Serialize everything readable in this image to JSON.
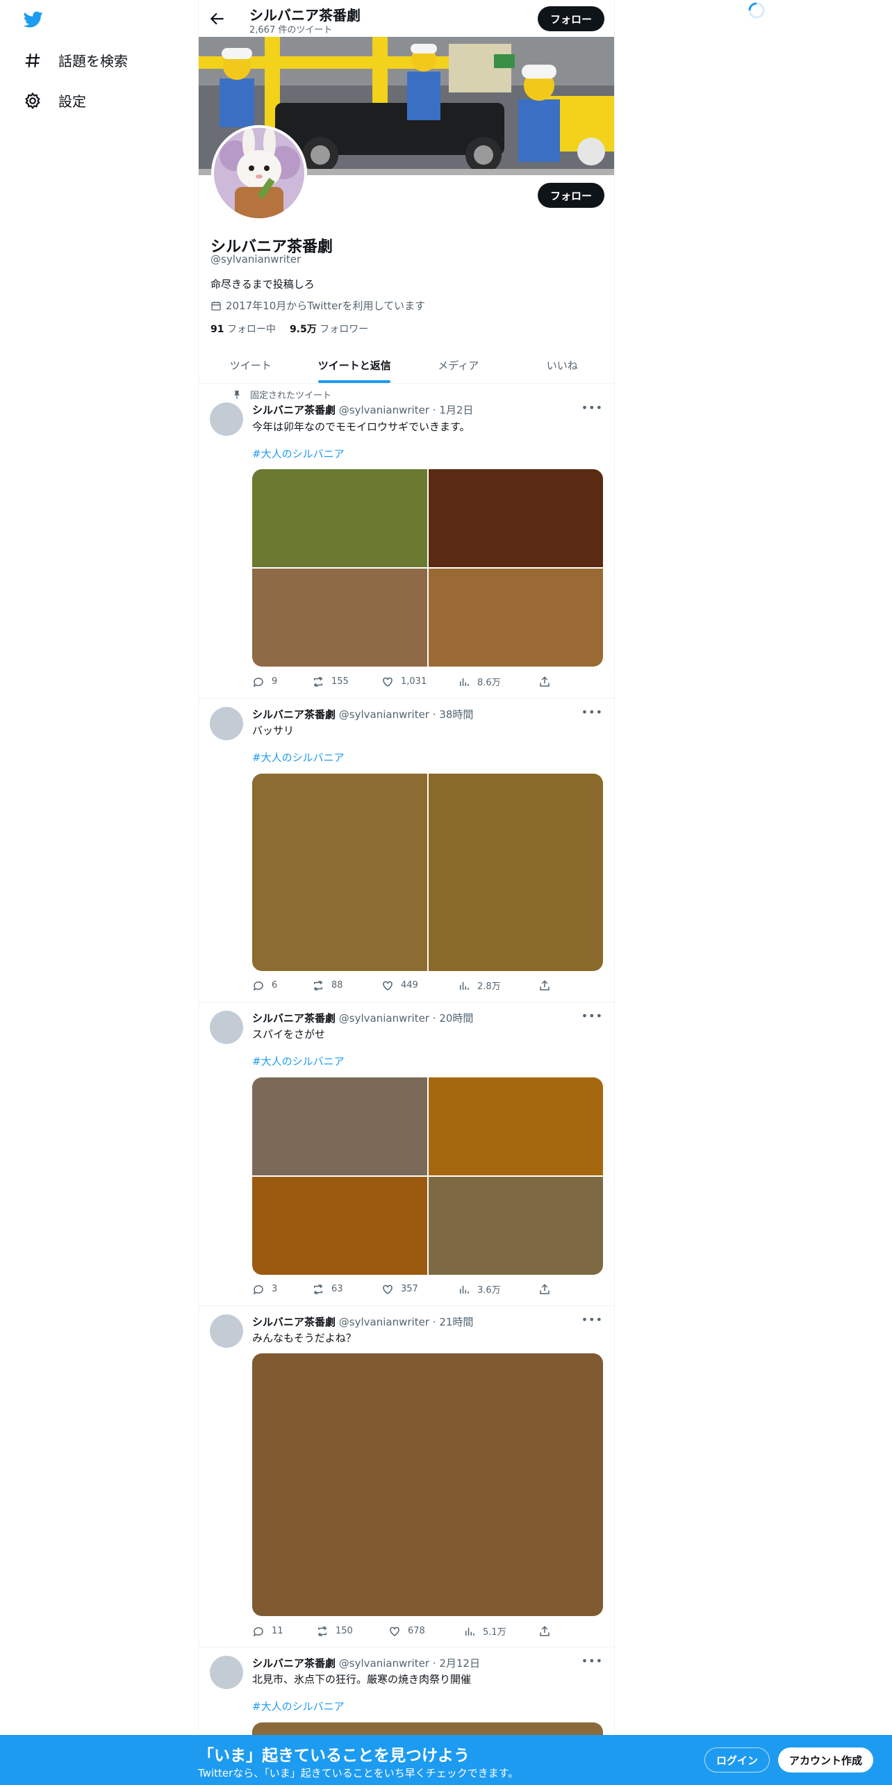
{
  "nav": {
    "explore_label": "話題を検索",
    "settings_label": "設定"
  },
  "header": {
    "name": "シルバニア茶番劇",
    "tweet_count": "2,667 件のツイート",
    "follow_label": "フォロー"
  },
  "profile": {
    "name": "シルバニア茶番劇",
    "handle": "@sylvanianwriter",
    "bio": "命尽きるまで投稿しろ",
    "joined": "2017年10月からTwitterを利用しています",
    "following_count": "91",
    "following_label": "フォロー中",
    "followers_count": "9.5万",
    "followers_label": "フォロワー",
    "follow_label": "フォロー"
  },
  "tabs": [
    {
      "label": "ツイート"
    },
    {
      "label": "ツイートと返信"
    },
    {
      "label": "メディア"
    },
    {
      "label": "いいね"
    }
  ],
  "pinned_label": "固定されたツイート",
  "tweets": [
    {
      "name": "シルバニア茶番劇",
      "handle": "@sylvanianwriter",
      "time": "1月2日",
      "text": "今年は卯年なのでモモイロウサギでいきます。",
      "hashtag": "#大人のシルバニア",
      "media_colors": [
        "#6a7a31",
        "#5a2a12",
        "#8e6b46",
        "#9a6a34"
      ],
      "replies": "9",
      "retweets": "155",
      "likes": "1,031",
      "views": "8.6万"
    },
    {
      "name": "シルバニア茶番劇",
      "handle": "@sylvanianwriter",
      "time": "38時間",
      "text": "バッサリ",
      "hashtag": "#大人のシルバニア",
      "media_colors": [
        "#8c6c30",
        "#8a6a2a"
      ],
      "replies": "6",
      "retweets": "88",
      "likes": "449",
      "views": "2.8万"
    },
    {
      "name": "シルバニア茶番劇",
      "handle": "@sylvanianwriter",
      "time": "20時間",
      "text": "スパイをさがせ",
      "hashtag": "#大人のシルバニア",
      "media_colors": [
        "#7c6a58",
        "#a6680e",
        "#9c5a10",
        "#7e6a42"
      ],
      "replies": "3",
      "retweets": "63",
      "likes": "357",
      "views": "3.6万"
    },
    {
      "name": "シルバニア茶番劇",
      "handle": "@sylvanianwriter",
      "time": "21時間",
      "text": "みんなもそうだよね？",
      "hashtag": "",
      "media_colors": [
        "#7f5a31"
      ],
      "replies": "11",
      "retweets": "150",
      "likes": "678",
      "views": "5.1万"
    },
    {
      "name": "シルバニア茶番劇",
      "handle": "@sylvanianwriter",
      "time": "2月12日",
      "text": "北見市、氷点下の狂行。厳寒の焼き肉祭り開催",
      "hashtag": "#大人のシルバニア",
      "media_colors": [
        "#8a6a3a"
      ]
    }
  ],
  "bottom": {
    "title": "「いま」起きていることを見つけよう",
    "subtitle": "Twitterなら、「いま」起きていることをいち早くチェックできます。",
    "login_label": "ログイン",
    "signup_label": "アカウント作成"
  },
  "colors": {
    "accent": "#1d9bf0",
    "text": "#0f1419",
    "muted": "#536471"
  }
}
